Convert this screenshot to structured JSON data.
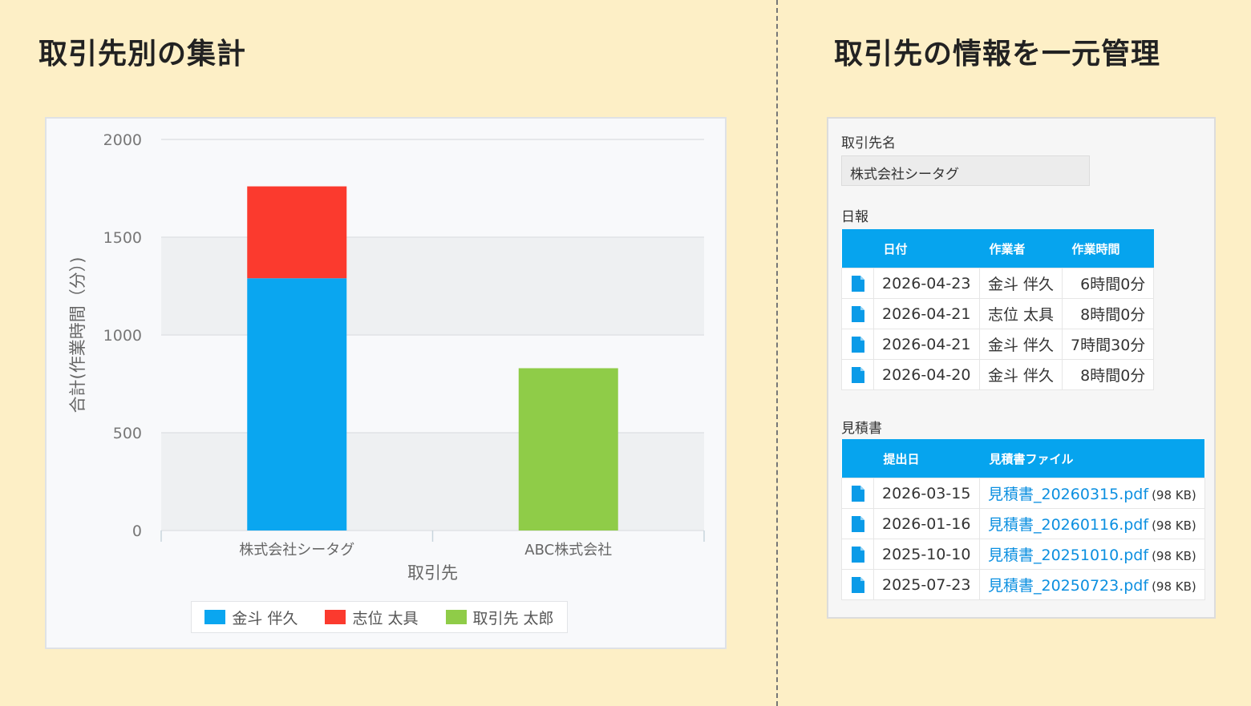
{
  "left_panel": {
    "title": "取引先別の集計"
  },
  "right_panel": {
    "title": "取引先の情報を一元管理"
  },
  "chart_data": {
    "type": "bar",
    "stacked": true,
    "categories": [
      "株式会社シータグ",
      "ABC株式会社"
    ],
    "series": [
      {
        "name": "金斗 伴久",
        "color": "#0aa6f0",
        "values": [
          1290,
          0
        ]
      },
      {
        "name": "志位 太具",
        "color": "#fb3a2e",
        "values": [
          470,
          0
        ]
      },
      {
        "name": "取引先 太郎",
        "color": "#8fcc48",
        "values": [
          0,
          830
        ]
      }
    ],
    "xlabel": "取引先",
    "ylabel": "合計(作業時間（分）)",
    "yticks": [
      0,
      500,
      1000,
      1500,
      2000
    ],
    "ylim": [
      0,
      2000
    ],
    "legend_position": "bottom",
    "grid": true
  },
  "record": {
    "client_name_label": "取引先名",
    "client_name_value": "株式会社シータグ",
    "daily_report": {
      "label": "日報",
      "headers": {
        "date": "日付",
        "worker": "作業者",
        "hours": "作業時間"
      },
      "rows": [
        {
          "date": "2026-04-23",
          "worker": "金斗 伴久",
          "hours": "6時間0分"
        },
        {
          "date": "2026-04-21",
          "worker": "志位 太具",
          "hours": "8時間0分"
        },
        {
          "date": "2026-04-21",
          "worker": "金斗 伴久",
          "hours": "7時間30分"
        },
        {
          "date": "2026-04-20",
          "worker": "金斗 伴久",
          "hours": "8時間0分"
        }
      ]
    },
    "estimates": {
      "label": "見積書",
      "headers": {
        "date": "提出日",
        "file": "見積書ファイル"
      },
      "rows": [
        {
          "date": "2026-03-15",
          "file": "見積書_20260315.pdf",
          "size": "(98 KB)"
        },
        {
          "date": "2026-01-16",
          "file": "見積書_20260116.pdf",
          "size": "(98 KB)"
        },
        {
          "date": "2025-10-10",
          "file": "見積書_20251010.pdf",
          "size": "(98 KB)"
        },
        {
          "date": "2025-07-23",
          "file": "見積書_20250723.pdf",
          "size": "(98 KB)"
        }
      ]
    }
  }
}
